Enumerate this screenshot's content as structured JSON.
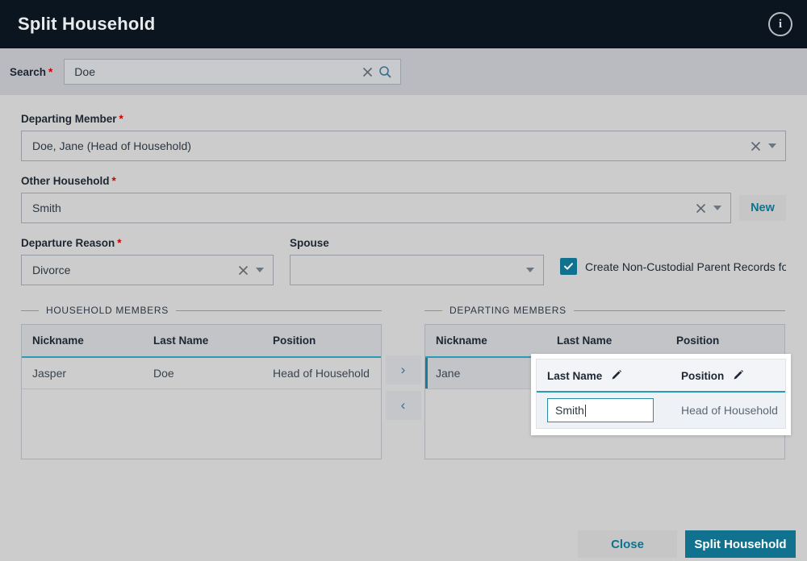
{
  "window": {
    "title": "Split Household",
    "info_icon": "info-circle-icon"
  },
  "search": {
    "label": "Search",
    "required_mark": "*",
    "value": "Doe",
    "clear_icon": "close-x-icon",
    "search_icon": "magnifier-icon"
  },
  "form": {
    "departing_member": {
      "label": "Departing Member",
      "required_mark": "*",
      "value": "Doe, Jane (Head of Household)"
    },
    "other_household": {
      "label": "Other Household",
      "required_mark": "*",
      "value": "Smith",
      "new_button": "New"
    },
    "departure_reason": {
      "label": "Departure Reason",
      "required_mark": "*",
      "value": "Divorce"
    },
    "spouse": {
      "label": "Spouse",
      "value": ""
    },
    "non_custodial": {
      "label": "Create Non-Custodial Parent Records for M",
      "checked": true
    }
  },
  "household_members": {
    "legend": "HOUSEHOLD MEMBERS",
    "columns": [
      "Nickname",
      "Last Name",
      "Position"
    ],
    "rows": [
      {
        "nickname": "Jasper",
        "last_name": "Doe",
        "position": "Head of Household"
      }
    ]
  },
  "transfer": {
    "move_right": "›",
    "move_left": "‹"
  },
  "departing_members": {
    "legend": "DEPARTING MEMBERS",
    "columns": [
      "Nickname",
      "Last Name",
      "Position"
    ],
    "rows": [
      {
        "nickname": "Jane",
        "last_name": "Smith",
        "position": "Head of Household"
      }
    ]
  },
  "edit_overlay": {
    "columns": [
      "Last Name",
      "Position"
    ],
    "edit_icon": "pencil-icon",
    "input_value": "Smith",
    "position_value": "Head of Household"
  },
  "footer": {
    "close": "Close",
    "submit": "Split Household"
  },
  "colors": {
    "header_bg": "#0b1520",
    "accent_teal": "#10728f",
    "grid_underline": "#2a9bb5",
    "required_red": "#cc0000",
    "body_bg": "#cccccc",
    "search_bg": "#b9bbc0"
  }
}
